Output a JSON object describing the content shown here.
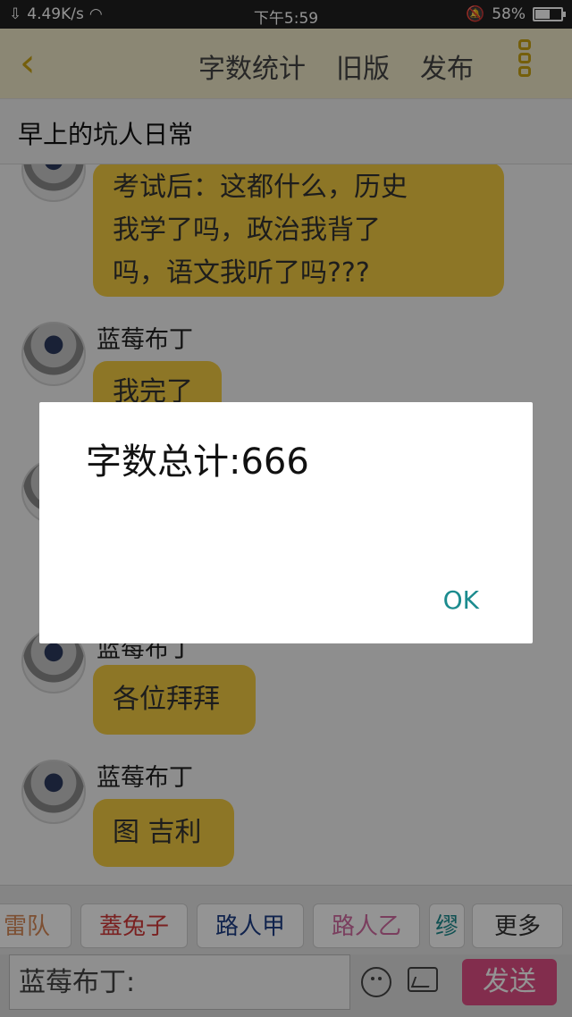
{
  "status": {
    "speed": "4.49K/s",
    "time": "下午5:59",
    "battery": "58%",
    "battery_level": 0.58
  },
  "appbar": {
    "back_icon": "chevron-left-icon",
    "actions": [
      "字数统计",
      "旧版",
      "发布"
    ],
    "menu_icon": "more-vertical-icon"
  },
  "title": "早上的坑人日常",
  "messages": [
    {
      "text_line1": "考试后：这都什么，历史",
      "text_line2": "我学了吗，政治我背了",
      "text_line3": "吗，语文我听了吗???"
    },
    {
      "name": "蓝莓布丁",
      "text": "我完了"
    },
    {
      "name": "蓝莓布丁",
      "text": "各位拜拜"
    },
    {
      "name": "蓝莓布丁",
      "text": "图 吉利"
    }
  ],
  "tags": [
    "雷队",
    "蓋兔子",
    "路人甲",
    "路人乙",
    "缪",
    "更多"
  ],
  "input": {
    "value": "蓝莓布丁:"
  },
  "send_label": "发送",
  "dialog": {
    "message": "字数总计:666",
    "ok_label": "OK"
  },
  "colors": {
    "accent": "#f3cc43",
    "send": "#e14f86",
    "ok": "#1b8b8e"
  }
}
